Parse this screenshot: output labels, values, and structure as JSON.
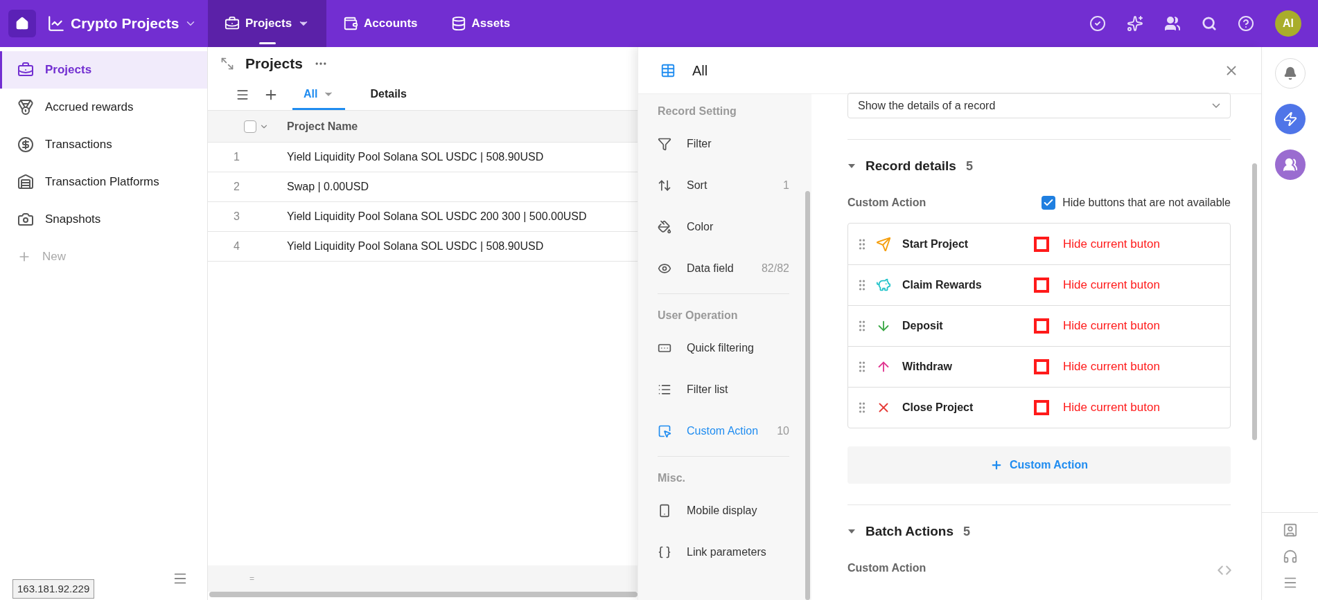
{
  "app": {
    "title": "Crypto Projects"
  },
  "top_tabs": [
    {
      "label": "Projects",
      "selected": true
    },
    {
      "label": "Accounts",
      "selected": false
    },
    {
      "label": "Assets",
      "selected": false
    }
  ],
  "user": {
    "initials": "Al"
  },
  "sidebar": {
    "items": [
      {
        "label": "Projects",
        "selected": true
      },
      {
        "label": "Accrued rewards",
        "selected": false
      },
      {
        "label": "Transactions",
        "selected": false
      },
      {
        "label": "Transaction Platforms",
        "selected": false
      },
      {
        "label": "Snapshots",
        "selected": false
      }
    ],
    "new_label": "New"
  },
  "view": {
    "title": "Projects",
    "tabs": [
      {
        "label": "All",
        "selected": true
      },
      {
        "label": "Details",
        "selected": false
      }
    ],
    "table": {
      "select_all_checked": false,
      "columns": [
        "Project Name"
      ],
      "rows": [
        {
          "index": "1",
          "name": "Yield Liquidity Pool Solana SOL USDC | 508.90USD"
        },
        {
          "index": "2",
          "name": "Swap | 0.00USD"
        },
        {
          "index": "3",
          "name": "Yield Liquidity Pool Solana SOL USDC 200 300 | 500.00USD"
        },
        {
          "index": "4",
          "name": "Yield Liquidity Pool Solana SOL USDC | 508.90USD"
        }
      ],
      "footer_mark": "="
    }
  },
  "status": {
    "ip": "163.181.92.229"
  },
  "panel": {
    "title": "All",
    "nav": [
      {
        "heading": "Record Setting",
        "items": [
          {
            "label": "Filter",
            "selected": false
          },
          {
            "label": "Sort",
            "count": "1",
            "selected": false
          },
          {
            "label": "Color",
            "selected": false
          },
          {
            "label": "Data field",
            "count": "82/82",
            "selected": false
          }
        ]
      },
      {
        "heading": "User Operation",
        "items": [
          {
            "label": "Quick filtering",
            "selected": false
          },
          {
            "label": "Filter list",
            "selected": false
          },
          {
            "label": "Custom Action",
            "count": "10",
            "selected": true
          }
        ]
      },
      {
        "heading": "Misc.",
        "items": [
          {
            "label": "Mobile display",
            "selected": false
          },
          {
            "label": "Link parameters",
            "selected": false
          }
        ]
      }
    ],
    "select_value": "Show the details of a record",
    "sections": [
      {
        "title": "Record details",
        "count": "5",
        "expanded": true,
        "subheading": "Custom Action",
        "hide_unavailable": {
          "label": "Hide buttons that are not available",
          "checked": true
        },
        "actions": [
          {
            "kind": "send",
            "label": "Start Project",
            "hide": {
              "label": "Hide current buton",
              "checked": false
            }
          },
          {
            "kind": "piggy",
            "label": "Claim Rewards",
            "hide": {
              "label": "Hide current buton",
              "checked": false
            }
          },
          {
            "kind": "down",
            "label": "Deposit",
            "hide": {
              "label": "Hide current buton",
              "checked": false
            }
          },
          {
            "kind": "up",
            "label": "Withdraw",
            "hide": {
              "label": "Hide current buton",
              "checked": false
            }
          },
          {
            "kind": "close",
            "label": "Close Project",
            "hide": {
              "label": "Hide current buton",
              "checked": false
            }
          }
        ],
        "add_label": "Custom Action"
      },
      {
        "title": "Batch Actions",
        "count": "5",
        "expanded": true,
        "subheading": "Custom Action"
      }
    ]
  }
}
